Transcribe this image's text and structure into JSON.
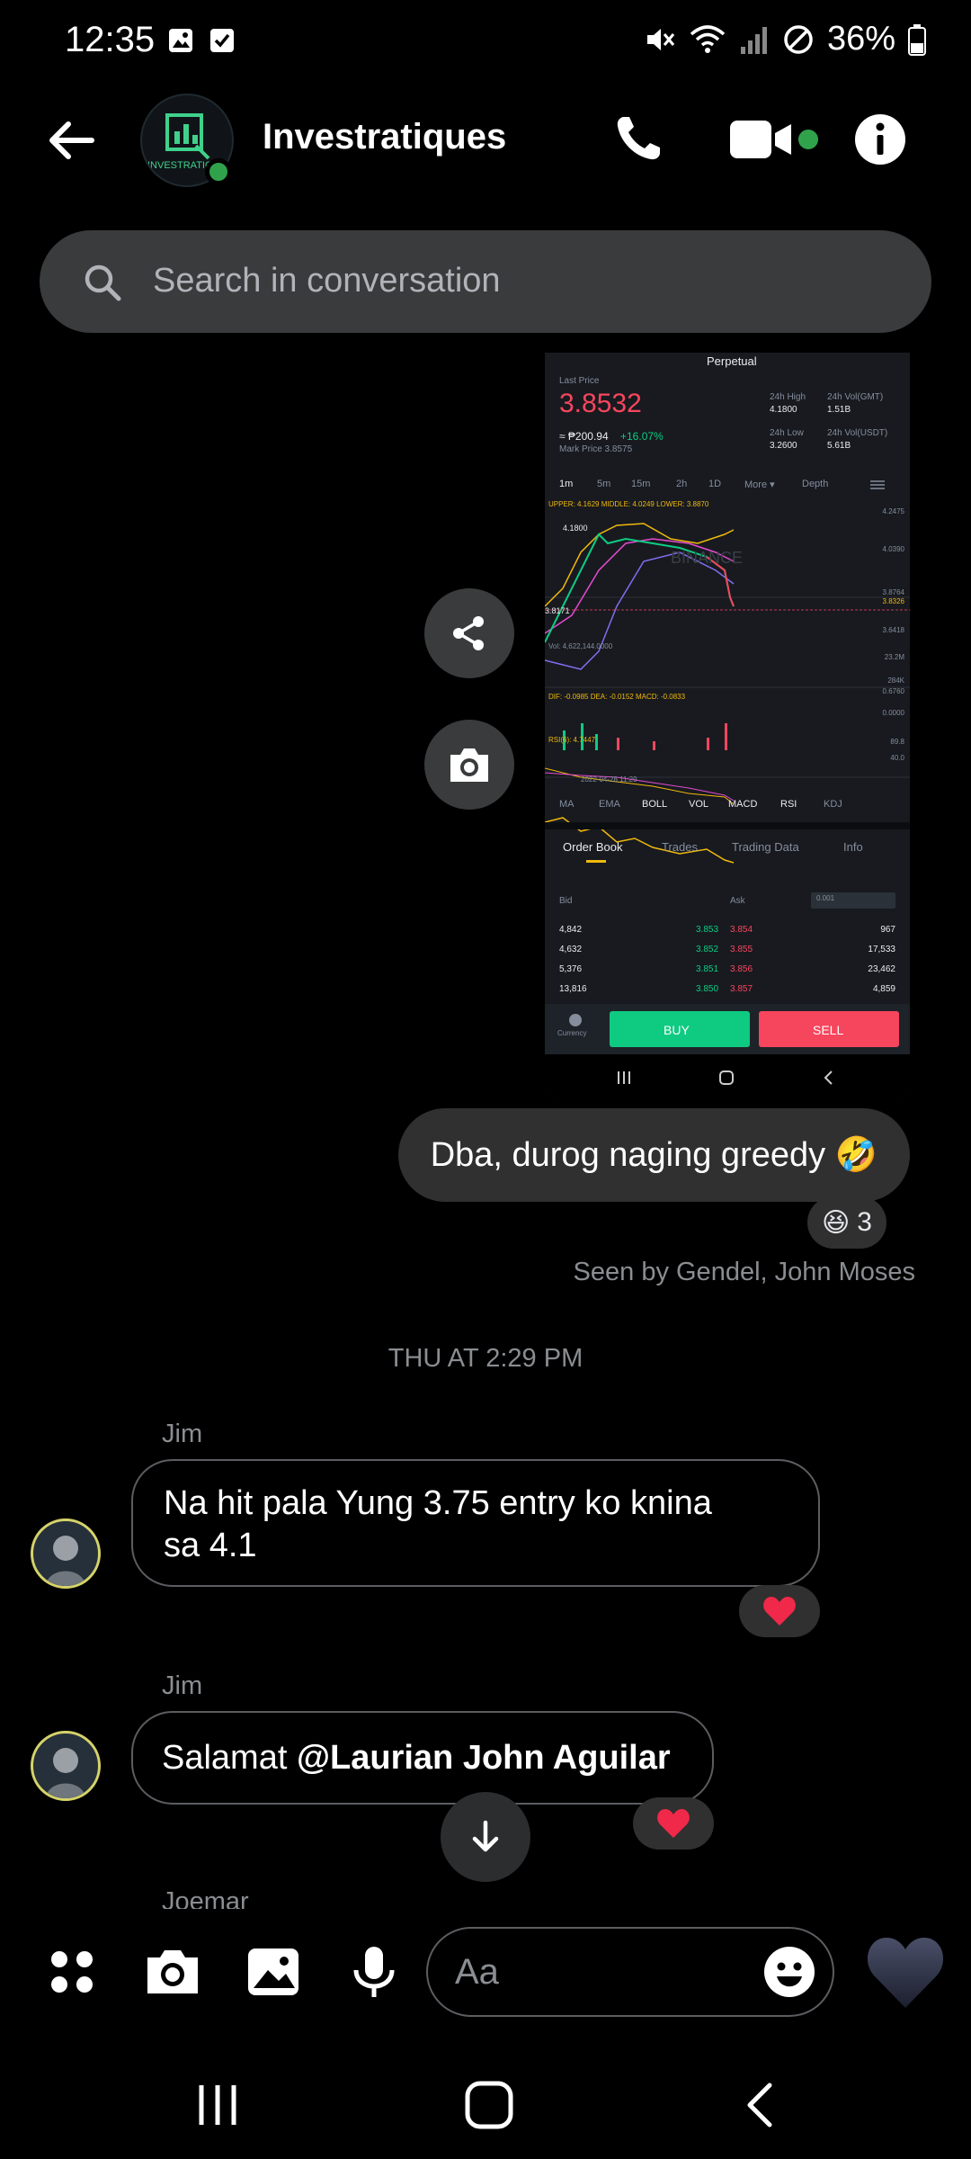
{
  "status_bar": {
    "time": "12:35",
    "battery": "36%"
  },
  "header": {
    "title": "Investratiques",
    "avatar_text": "INVESTRATIQ"
  },
  "search": {
    "placeholder": "Search in conversation"
  },
  "shared_image": {
    "title": "Perpetual",
    "last_price_label": "Last Price",
    "last_price": "3.8532",
    "fiat_price": "≈ ₱200.94",
    "change": "+16.07%",
    "mark_price": "Mark Price 3.8575",
    "stats": [
      {
        "label": "24h High",
        "value": "4.1800"
      },
      {
        "label": "24h Vol(GMT)",
        "value": "1.51B"
      },
      {
        "label": "24h Low",
        "value": "3.2600"
      },
      {
        "label": "24h Vol(USDT)",
        "value": "5.61B"
      }
    ],
    "timeframes": [
      "1m",
      "5m",
      "15m",
      "2h",
      "1D",
      "More ▾",
      "Depth"
    ],
    "boll_line": "UPPER: 4.1629   MIDDLE: 4.0249   LOWER: 3.8870",
    "chart_high": "4.1800",
    "chart_low": "3.8171",
    "price_axis": [
      "4.2475",
      "4.0390",
      "3.8764",
      "3.8326",
      "3.6418"
    ],
    "vol_line": "Vol: 4,622,144.0000",
    "vol_axis": [
      "23.2M",
      "284K",
      "0.6760",
      "0.0000"
    ],
    "macd_line": "DIF: -0.0985   DEA: -0.0152   MACD: -0.0833",
    "rsi_line": "RSI(6): 4.7447",
    "rsi_axis": [
      "89.8",
      "40.0"
    ],
    "timestamp": "2022-04-28 11:29",
    "indicators": [
      "MA",
      "EMA",
      "BOLL",
      "VOL",
      "MACD",
      "RSI",
      "KDJ"
    ],
    "tabs": [
      "Order Book",
      "Trades",
      "Trading Data",
      "Info"
    ],
    "order_headers": {
      "bid": "Bid",
      "ask": "Ask",
      "step": "0.001"
    },
    "order_rows": [
      {
        "bid_qty": "4,842",
        "bid": "3.853",
        "ask": "3.854",
        "ask_qty": "967"
      },
      {
        "bid_qty": "4,632",
        "bid": "3.852",
        "ask": "3.855",
        "ask_qty": "17,533"
      },
      {
        "bid_qty": "5,376",
        "bid": "3.851",
        "ask": "3.856",
        "ask_qty": "23,462"
      },
      {
        "bid_qty": "13,816",
        "bid": "3.850",
        "ask": "3.857",
        "ask_qty": "4,859"
      }
    ],
    "currency_label": "Currency",
    "buy_label": "BUY",
    "sell_label": "SELL",
    "watermark": "BINANCE"
  },
  "messages": {
    "outgoing": {
      "text": "Dba, durog naging greedy 🤣",
      "reaction_emoji": "😆",
      "reaction_count": "3"
    },
    "seen": "Seen by Gendel, John Moses",
    "date_separator": "THU AT 2:29 PM",
    "msg1": {
      "sender": "Jim",
      "line1": "Na hit pala Yung 3.75 entry ko knina",
      "line2": "sa 4.1"
    },
    "msg2": {
      "sender": "Jim",
      "text_prefix": "Salamat ",
      "mention": "@Laurian John Aguilar"
    },
    "next_sender": "Joemar"
  },
  "composer": {
    "placeholder": "Aa"
  },
  "colors": {
    "accent_green": "#31a24c",
    "up": "#0ecb81",
    "down": "#f6465d",
    "binance_yellow": "#f0b90b"
  }
}
